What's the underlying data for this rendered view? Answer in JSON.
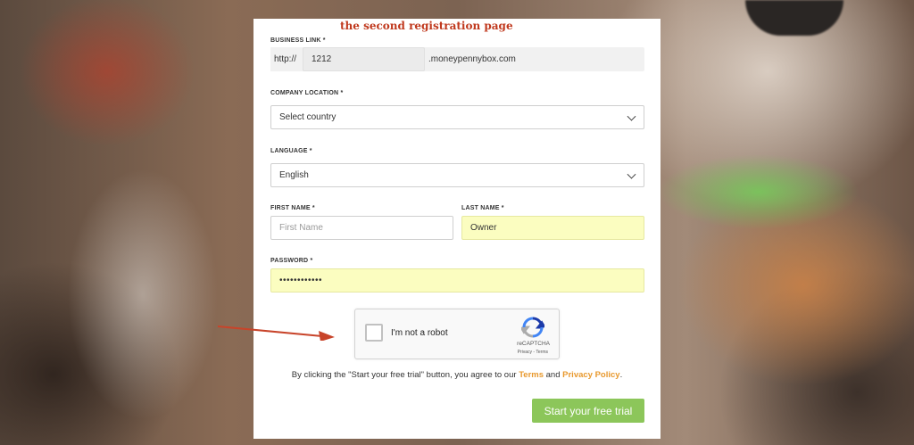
{
  "annotation": {
    "note": "the second registration page"
  },
  "form": {
    "business_link": {
      "label": "BUSINESS LINK *",
      "prefix": "http://",
      "value": "1212",
      "suffix": ".moneypennybox.com"
    },
    "company_location": {
      "label": "COMPANY LOCATION *",
      "value": "Select country"
    },
    "language": {
      "label": "LANGUAGE *",
      "value": "English"
    },
    "first_name": {
      "label": "FIRST NAME *",
      "placeholder": "First Name"
    },
    "last_name": {
      "label": "LAST NAME *",
      "value": "Owner"
    },
    "password": {
      "label": "PASSWORD *",
      "value": "••••••••••••"
    }
  },
  "captcha": {
    "label": "I'm not a robot",
    "brand": "reCAPTCHA",
    "links": "Privacy - Terms",
    "icon": "recaptcha-logo-icon"
  },
  "terms": {
    "prefix": "By clicking the \"Start your free trial\" button, you agree to our",
    "terms_link": "Terms",
    "and": "and",
    "privacy_link": "Privacy Policy",
    "suffix": "."
  },
  "submit_label": "Start your free trial",
  "colors": {
    "accent_orange": "#e8992e",
    "submit_green": "#8cc65a",
    "annotation_red": "#c0391e",
    "filled_field": "#fbfdc0"
  }
}
